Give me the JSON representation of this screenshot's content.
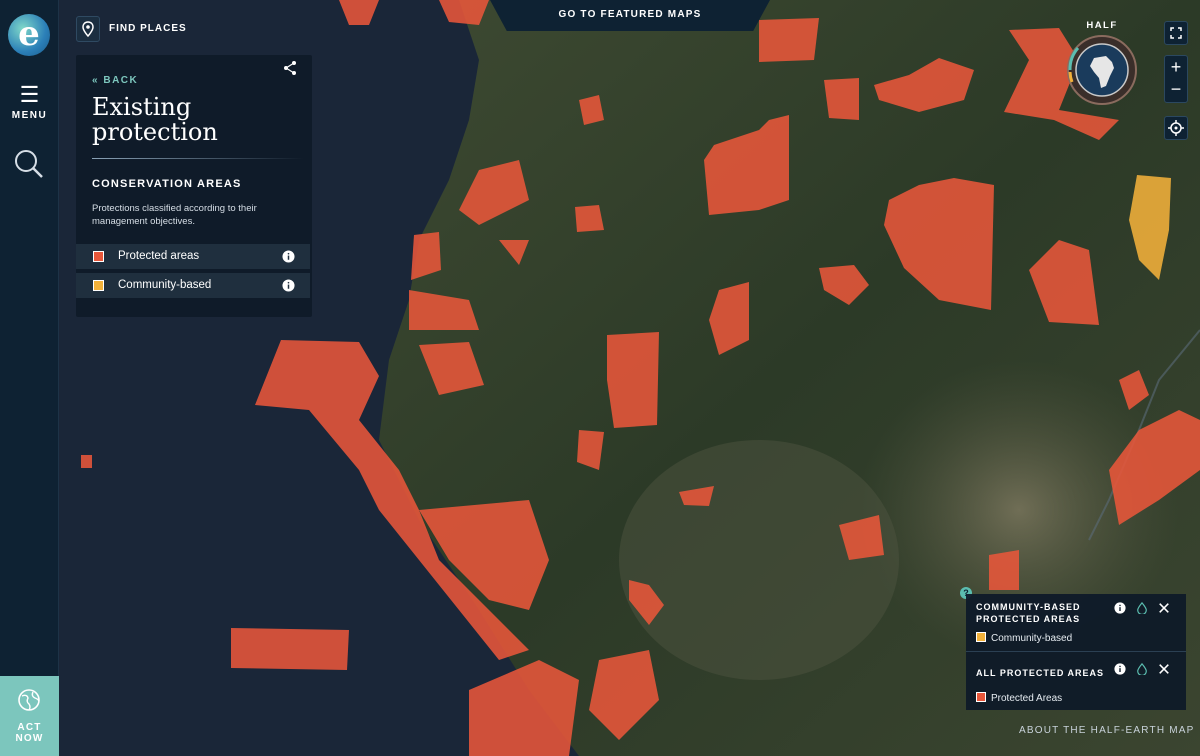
{
  "rail": {
    "menu_label": "MENU",
    "act_now_label_1": "ACT",
    "act_now_label_2": "NOW"
  },
  "find_places": {
    "label": "FIND PLACES"
  },
  "featured_maps": {
    "label": "GO TO FEATURED MAPS"
  },
  "panel": {
    "back_label": "BACK",
    "title": "Existing protection",
    "section_title": "CONSERVATION AREAS",
    "description": "Protections classified according to their management objectives.",
    "layers": [
      {
        "label": "Protected areas",
        "color": "#e8573a"
      },
      {
        "label": "Community-based",
        "color": "#f2b13a"
      }
    ]
  },
  "globe": {
    "label": "HALF"
  },
  "legend": {
    "blocks": [
      {
        "title_1": "COMMUNITY-BASED",
        "title_2": "PROTECTED AREAS",
        "item": "Community-based",
        "color": "#f2b13a"
      },
      {
        "title_1": "ALL PROTECTED AREAS",
        "item": "Protected Areas",
        "color": "#e8573a"
      }
    ],
    "help_label": "?"
  },
  "about_link": "ABOUT THE HALF-EARTH MAP",
  "colors": {
    "protected": "#e8573a",
    "community": "#f2b13a",
    "accent": "#7cc6bd",
    "panel": "#0e2233"
  }
}
